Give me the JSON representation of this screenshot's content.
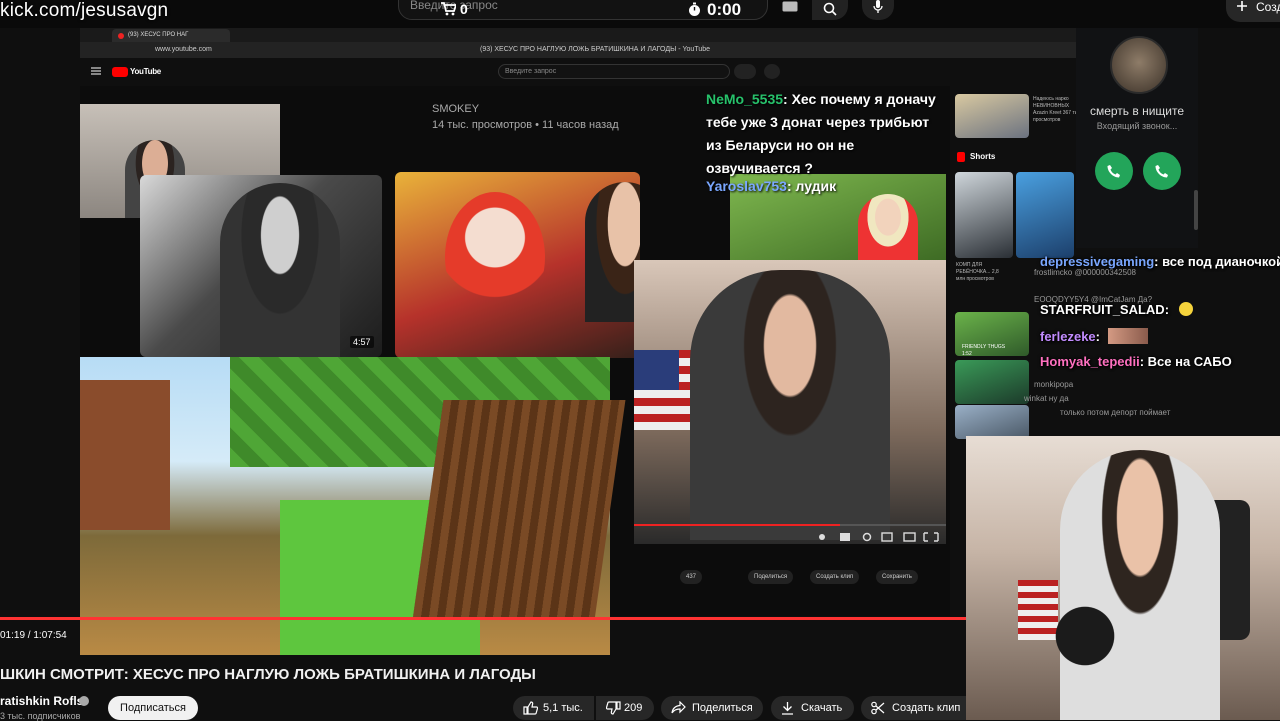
{
  "overlay": {
    "watermark": "kick.com/jesusavgn",
    "cart_count": "0",
    "timer": "0:00",
    "search_placeholder": "Введите запрос",
    "create_label": "Создать"
  },
  "inner_browser": {
    "tab_title": "(93) ХЕСУС ПРО НАГ",
    "url": "www.youtube.com",
    "page_title": "(93) ХЕСУС ПРО НАГЛУЮ ЛОЖЬ БРАТИШКИНА И ЛАГОДЫ - YouTube",
    "logo_text": "YouTube",
    "search_placeholder": "Введите запрос"
  },
  "inner_page": {
    "card_channel": "SMOKEY",
    "card_meta": "14 тыс. просмотров • 11 часов назад",
    "bw_duration": "4:57",
    "shorts_label": "Shorts",
    "side_items": [
      {
        "text": "Надеюсь нарко НЕВИНОВНЫХ Azazin Kreet 367 тыс. просмотров"
      },
      {
        "text": "КОМП ДЛЯ РЕБЁНОЧКА... 2,8 млн просмотров"
      },
      {
        "text": "FRIENDLY THUGS 1:52"
      }
    ],
    "action_buttons": [
      {
        "label": "437"
      },
      {
        "label": "Поделиться"
      },
      {
        "label": "Создать клип"
      },
      {
        "label": "Сохранить"
      }
    ]
  },
  "stream_chat_inner": {
    "msg1_user": "NeMo_5535",
    "msg1_text": ": Хес почему я доначу тебе уже 3 донат через трибьют из Беларуси но он не озвучивается ?",
    "msg2_user": "Yaroslav753",
    "msg2_text": ": лудик"
  },
  "call": {
    "name": "смерть в нищите",
    "status": "Входящий звонок..."
  },
  "stream_chat": [
    {
      "user": "depressivegaming",
      "text": ": все под дианочкой ползают",
      "color": "#7aa7ff"
    },
    {
      "user": "STARFRUIT_SALAD",
      "text": ":",
      "color": "#ffffff"
    },
    {
      "user": "ferlezeke",
      "text": ":",
      "color": "#c28cff"
    },
    {
      "user": "Homyak_tepedii",
      "text": ": Все на САБО",
      "color": "#ff70c0"
    }
  ],
  "chat_ghosts": [
    {
      "text": "frostlimcko @000000342508"
    },
    {
      "text": "EOOQDYY5Y4 @ImCatJam Да?"
    },
    {
      "text": "monkipopa"
    },
    {
      "text": "winkat ну да"
    },
    {
      "text": "только потом депорт поймает"
    }
  ],
  "player": {
    "time": "01:19 / 1:07:54",
    "progress": 1.0,
    "title": "ШКИН СМОТРИТ: ХЕСУС ПРО НАГЛУЮ ЛОЖЬ БРАТИШКИНА И ЛАГОДЫ",
    "channel": "ratishkin Rofls",
    "subs": "3 тыс. подписчиков",
    "subscribe_label": "Подписаться",
    "likes": "5,1 тыс.",
    "dislikes": "209",
    "share_label": "Поделиться",
    "download_label": "Скачать",
    "clip_label": "Создать клип"
  }
}
